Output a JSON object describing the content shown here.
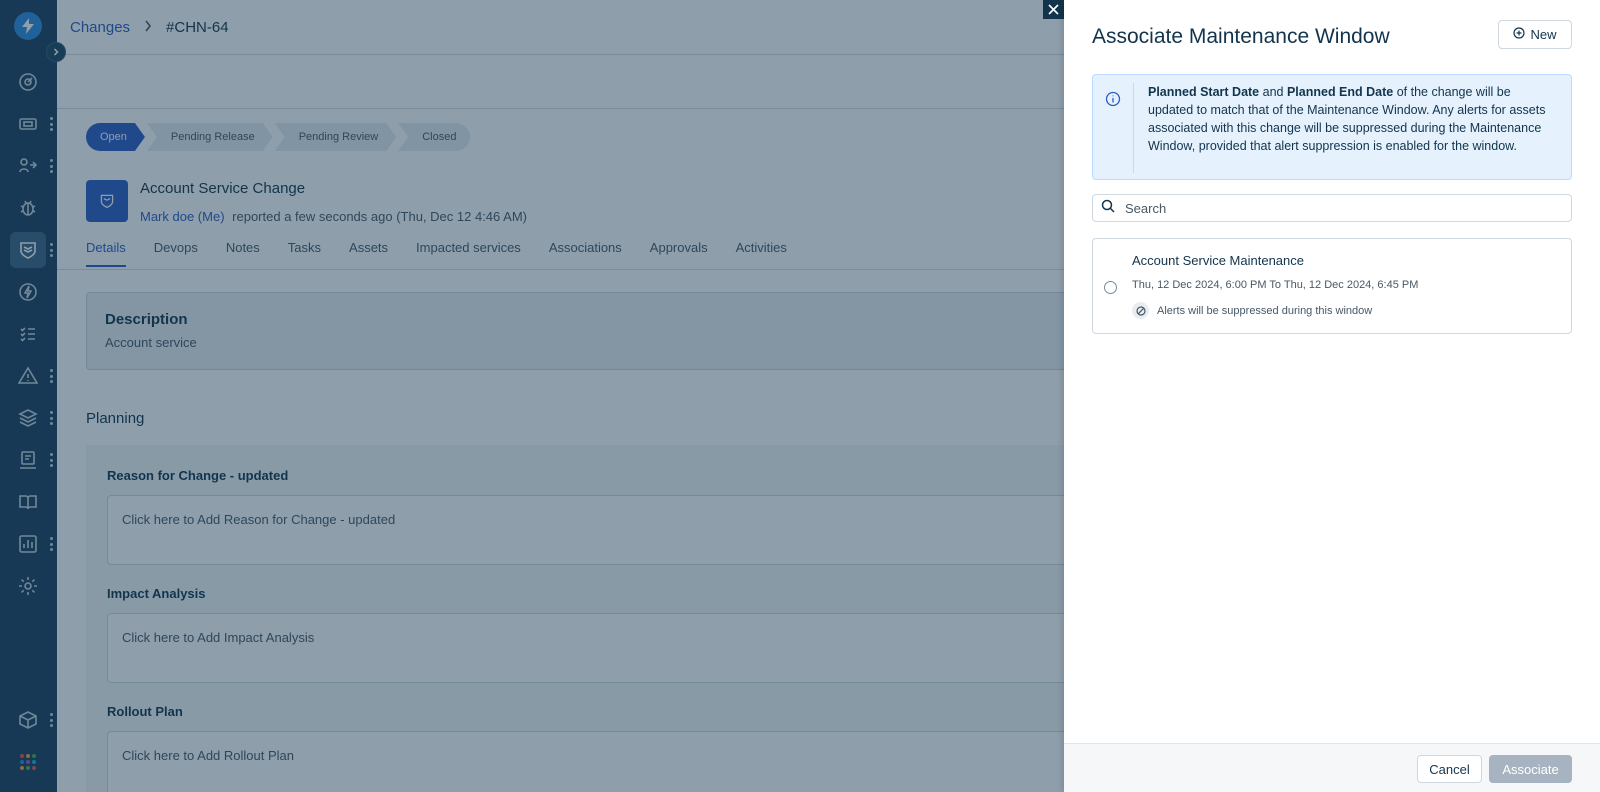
{
  "breadcrumb": {
    "parent": "Changes",
    "separator": ">",
    "current": "#CHN-64"
  },
  "stepper": [
    "Open",
    "Pending Release",
    "Pending Review",
    "Closed"
  ],
  "ticket": {
    "title": "Account Service Change",
    "requester": "Mark doe (Me)",
    "reported": "reported a few seconds ago (Thu, Dec 12 4:46 AM)"
  },
  "tabs": [
    "Details",
    "Devops",
    "Notes",
    "Tasks",
    "Assets",
    "Impacted services",
    "Associations",
    "Approvals",
    "Activities"
  ],
  "description": {
    "title": "Description",
    "text": "Account service"
  },
  "planning": {
    "title": "Planning",
    "fields": [
      {
        "label": "Reason for Change - updated",
        "placeholder": "Click here to Add Reason for Change - updated"
      },
      {
        "label": "Impact Analysis",
        "placeholder": "Click here to Add Impact Analysis"
      },
      {
        "label": "Rollout Plan",
        "placeholder": "Click here to Add Rollout Plan"
      }
    ]
  },
  "drawer": {
    "title": "Associate Maintenance Window",
    "new_label": "New",
    "info": {
      "bold1": "Planned Start Date",
      "mid1": " and ",
      "bold2": "Planned End Date",
      "rest": " of the change will be updated to match that of the Maintenance Window. Any alerts for assets associated with this change will be suppressed during the Maintenance Window, provided that alert suppression is enabled for the window."
    },
    "search_placeholder": "Search",
    "window": {
      "title": "Account Service Maintenance",
      "dates": "Thu, 12 Dec 2024, 6:00 PM To Thu, 12 Dec 2024, 6:45 PM",
      "alert": "Alerts will be suppressed during this window"
    },
    "cancel_label": "Cancel",
    "associate_label": "Associate"
  },
  "sidebar_icons": [
    "dashboard-icon",
    "ticket-icon",
    "problem-icon",
    "bug-icon",
    "change-icon",
    "release-icon",
    "tasks-icon",
    "alert-icon",
    "layers-icon",
    "asset-icon",
    "book-icon",
    "report-icon",
    "settings-icon",
    "box-icon",
    "apps-icon"
  ],
  "colors": {
    "primary": "#2c5cc5",
    "sidebar": "#1b3f5c",
    "info_bg": "#e5f2fd"
  }
}
